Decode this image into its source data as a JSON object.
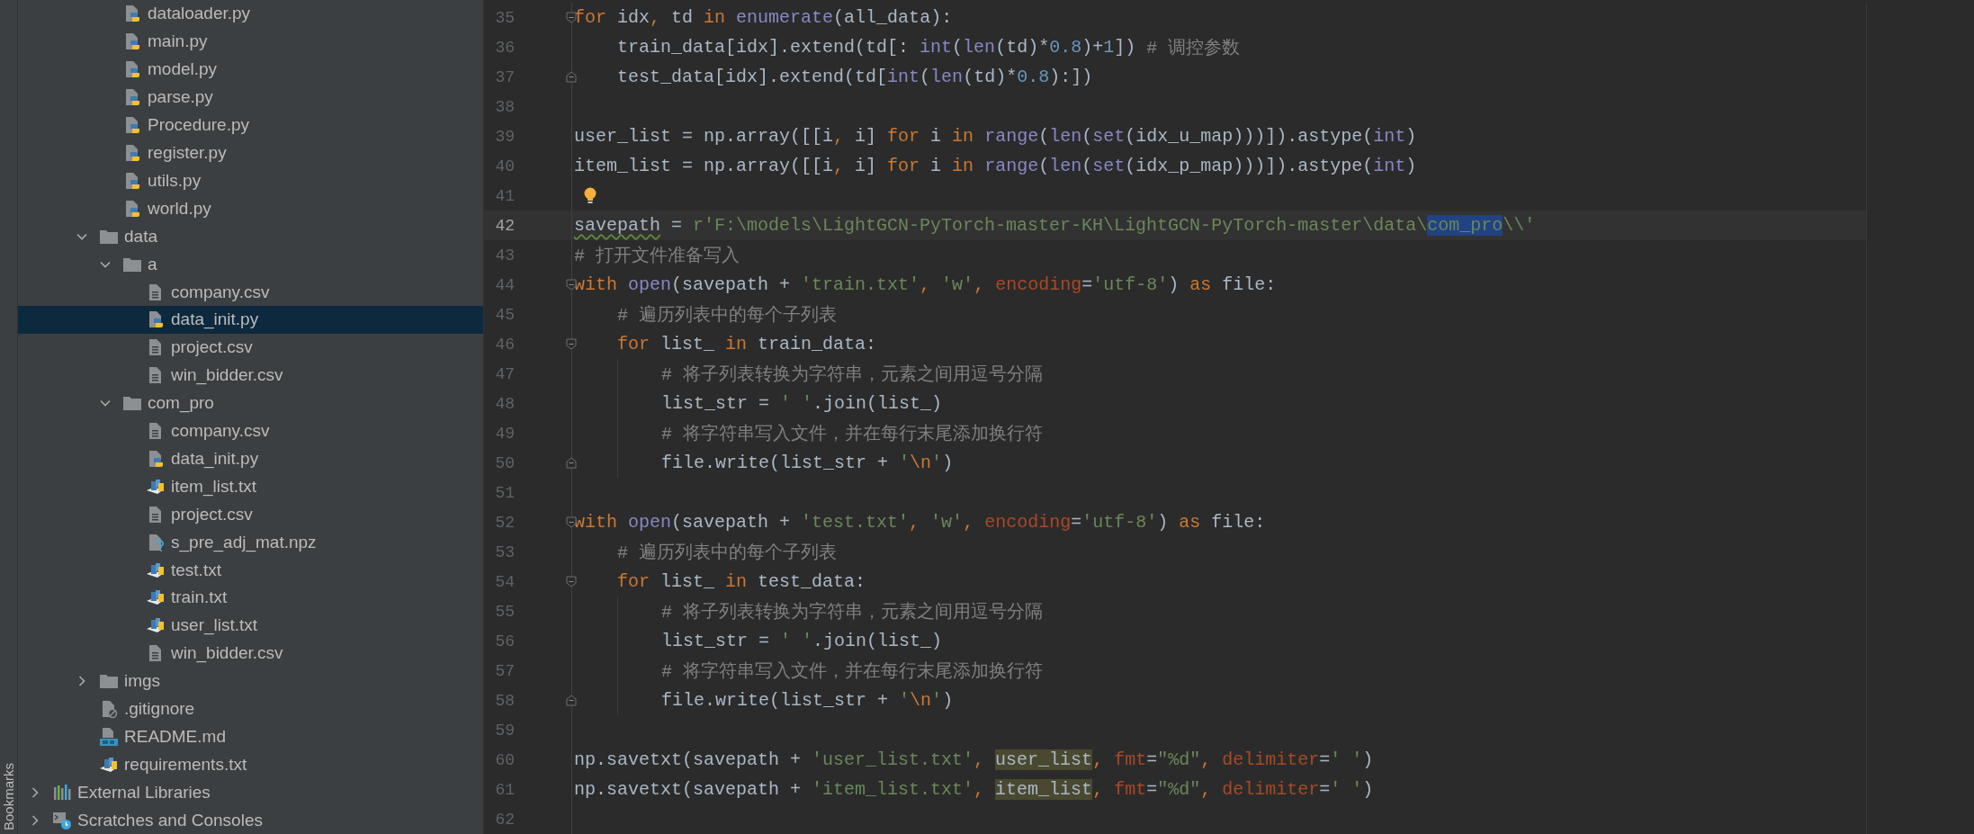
{
  "sidebar": {
    "label": "Bookmarks"
  },
  "tree": [
    {
      "children": [
        {
          "children": [
            {
              "children": [
                {
                  "label": "dataloader.py",
                  "kind": "python",
                  "selected": false
                },
                {
                  "label": "main.py",
                  "kind": "python",
                  "selected": false
                },
                {
                  "label": "model.py",
                  "kind": "python",
                  "selected": false
                },
                {
                  "label": "parse.py",
                  "kind": "python",
                  "selected": false
                },
                {
                  "label": "Procedure.py",
                  "kind": "python",
                  "selected": false
                },
                {
                  "label": "register.py",
                  "kind": "python",
                  "selected": false
                },
                {
                  "label": "utils.py",
                  "kind": "python",
                  "selected": false
                },
                {
                  "label": "world.py",
                  "kind": "python",
                  "selected": false
                }
              ]
            },
            {
              "label": "data",
              "kind": "folder",
              "expanded": true,
              "selected": false,
              "children": [
                {
                  "label": "a",
                  "kind": "folder",
                  "expanded": true,
                  "selected": false,
                  "children": [
                    {
                      "label": "company.csv",
                      "kind": "csv",
                      "selected": false
                    },
                    {
                      "label": "data_init.py",
                      "kind": "python",
                      "selected": true
                    },
                    {
                      "label": "project.csv",
                      "kind": "csv",
                      "selected": false
                    },
                    {
                      "label": "win_bidder.csv",
                      "kind": "csv",
                      "selected": false
                    }
                  ]
                },
                {
                  "label": "com_pro",
                  "kind": "folder",
                  "expanded": true,
                  "selected": false,
                  "children": [
                    {
                      "label": "company.csv",
                      "kind": "csv",
                      "selected": false
                    },
                    {
                      "label": "data_init.py",
                      "kind": "python",
                      "selected": false
                    },
                    {
                      "label": "item_list.txt",
                      "kind": "text",
                      "selected": false
                    },
                    {
                      "label": "project.csv",
                      "kind": "csv",
                      "selected": false
                    },
                    {
                      "label": "s_pre_adj_mat.npz",
                      "kind": "unknown",
                      "selected": false
                    },
                    {
                      "label": "test.txt",
                      "kind": "text",
                      "selected": false
                    },
                    {
                      "label": "train.txt",
                      "kind": "text",
                      "selected": false
                    },
                    {
                      "label": "user_list.txt",
                      "kind": "text",
                      "selected": false
                    },
                    {
                      "label": "win_bidder.csv",
                      "kind": "csv",
                      "selected": false
                    }
                  ]
                }
              ]
            },
            {
              "label": "imgs",
              "kind": "folder",
              "expanded": false,
              "selected": false
            },
            {
              "label": ".gitignore",
              "kind": "ignore",
              "selected": false
            },
            {
              "label": "README.md",
              "kind": "markdown",
              "selected": false
            },
            {
              "label": "requirements.txt",
              "kind": "text",
              "selected": false
            }
          ]
        }
      ]
    },
    {
      "label": "External Libraries",
      "kind": "libraries",
      "expanded": false,
      "selected": false
    },
    {
      "label": "Scratches and Consoles",
      "kind": "scratches",
      "expanded": false,
      "selected": false
    }
  ],
  "editor": {
    "lines": [
      {
        "number": "35",
        "current": false,
        "bulb": false,
        "fold_start": true,
        "fold_end": false,
        "tokens": [
          {
            "kind": "keyword",
            "text": "for"
          },
          {
            "kind": "plain",
            "text": " idx"
          },
          {
            "kind": "keyword",
            "text": ", "
          },
          {
            "kind": "plain",
            "text": "td "
          },
          {
            "kind": "keyword",
            "text": "in "
          },
          {
            "kind": "builtin",
            "text": "enumerate"
          },
          {
            "kind": "plain",
            "text": "(all_data):"
          }
        ],
        "children": [
          {
            "number": "36",
            "current": false,
            "bulb": false,
            "fold_start": false,
            "fold_end": false,
            "tokens": [
              {
                "kind": "plain",
                "text": "train_data[idx].extend(td[: "
              },
              {
                "kind": "builtin",
                "text": "int"
              },
              {
                "kind": "plain",
                "text": "("
              },
              {
                "kind": "builtin",
                "text": "len"
              },
              {
                "kind": "plain",
                "text": "(td)*"
              },
              {
                "kind": "number",
                "text": "0.8"
              },
              {
                "kind": "plain",
                "text": ")+"
              },
              {
                "kind": "number",
                "text": "1"
              },
              {
                "kind": "plain",
                "text": "]) "
              },
              {
                "kind": "comment",
                "text": "# 调控参数"
              }
            ]
          },
          {
            "number": "37",
            "current": false,
            "bulb": false,
            "fold_start": false,
            "fold_end": true,
            "tokens": [
              {
                "kind": "plain",
                "text": "test_data[idx].extend(td["
              },
              {
                "kind": "builtin",
                "text": "int"
              },
              {
                "kind": "plain",
                "text": "("
              },
              {
                "kind": "builtin",
                "text": "len"
              },
              {
                "kind": "plain",
                "text": "(td)*"
              },
              {
                "kind": "number",
                "text": "0.8"
              },
              {
                "kind": "plain",
                "text": "):])"
              }
            ]
          }
        ]
      },
      {
        "number": "38",
        "current": false,
        "bulb": false,
        "fold_start": false,
        "fold_end": false
      },
      {
        "number": "39",
        "current": false,
        "bulb": false,
        "fold_start": false,
        "fold_end": false,
        "tokens": [
          {
            "kind": "plain",
            "text": "user_list = np.array([[i"
          },
          {
            "kind": "keyword",
            "text": ", "
          },
          {
            "kind": "plain",
            "text": "i] "
          },
          {
            "kind": "keyword",
            "text": "for"
          },
          {
            "kind": "plain",
            "text": " i "
          },
          {
            "kind": "keyword",
            "text": "in "
          },
          {
            "kind": "builtin",
            "text": "range"
          },
          {
            "kind": "plain",
            "text": "("
          },
          {
            "kind": "builtin",
            "text": "len"
          },
          {
            "kind": "plain",
            "text": "("
          },
          {
            "kind": "builtin",
            "text": "set"
          },
          {
            "kind": "plain",
            "text": "(idx_u_map)))]).astype("
          },
          {
            "kind": "builtin",
            "text": "int"
          },
          {
            "kind": "plain",
            "text": ")"
          }
        ]
      },
      {
        "number": "40",
        "current": false,
        "bulb": false,
        "fold_start": false,
        "fold_end": false,
        "tokens": [
          {
            "kind": "plain",
            "text": "item_list = np.array([[i"
          },
          {
            "kind": "keyword",
            "text": ", "
          },
          {
            "kind": "plain",
            "text": "i] "
          },
          {
            "kind": "keyword",
            "text": "for"
          },
          {
            "kind": "plain",
            "text": " i "
          },
          {
            "kind": "keyword",
            "text": "in "
          },
          {
            "kind": "builtin",
            "text": "range"
          },
          {
            "kind": "plain",
            "text": "("
          },
          {
            "kind": "builtin",
            "text": "len"
          },
          {
            "kind": "plain",
            "text": "("
          },
          {
            "kind": "builtin",
            "text": "set"
          },
          {
            "kind": "plain",
            "text": "(idx_p_map)))]).astype("
          },
          {
            "kind": "builtin",
            "text": "int"
          },
          {
            "kind": "plain",
            "text": ")"
          }
        ]
      },
      {
        "number": "41",
        "current": false,
        "bulb": true,
        "fold_start": false,
        "fold_end": false
      },
      {
        "number": "42",
        "current": true,
        "bulb": false,
        "fold_start": false,
        "fold_end": false,
        "tokens": [
          {
            "kind": "warn",
            "text": "savepath"
          },
          {
            "kind": "plain",
            "text": " = "
          },
          {
            "kind": "string",
            "text": "r'F:\\models\\LightGCN-PyTorch-master-KH\\LightGCN-PyTorch-master\\data\\"
          },
          {
            "kind": "string",
            "text": "com_pro",
            "selected": true
          },
          {
            "kind": "string",
            "text": "\\\\'"
          }
        ]
      },
      {
        "number": "43",
        "current": false,
        "bulb": false,
        "fold_start": false,
        "fold_end": false,
        "tokens": [
          {
            "kind": "comment",
            "text": "# 打开文件准备写入"
          }
        ]
      },
      {
        "number": "44",
        "current": false,
        "bulb": false,
        "fold_start": true,
        "fold_end": false,
        "tokens": [
          {
            "kind": "keyword",
            "text": "with "
          },
          {
            "kind": "builtin",
            "text": "open"
          },
          {
            "kind": "plain",
            "text": "(savepath + "
          },
          {
            "kind": "string",
            "text": "'train.txt'"
          },
          {
            "kind": "keyword",
            "text": ", "
          },
          {
            "kind": "string",
            "text": "'w'"
          },
          {
            "kind": "keyword",
            "text": ", "
          },
          {
            "kind": "param",
            "text": "encoding"
          },
          {
            "kind": "plain",
            "text": "="
          },
          {
            "kind": "string",
            "text": "'utf-8'"
          },
          {
            "kind": "plain",
            "text": ") "
          },
          {
            "kind": "keyword",
            "text": "as"
          },
          {
            "kind": "plain",
            "text": " file:"
          }
        ],
        "children": [
          {
            "number": "45",
            "current": false,
            "bulb": false,
            "fold_start": false,
            "fold_end": false,
            "tokens": [
              {
                "kind": "comment",
                "text": "# 遍历列表中的每个子列表"
              }
            ]
          },
          {
            "number": "46",
            "current": false,
            "bulb": false,
            "fold_start": true,
            "fold_end": false,
            "tokens": [
              {
                "kind": "keyword",
                "text": "for"
              },
              {
                "kind": "plain",
                "text": " list_ "
              },
              {
                "kind": "keyword",
                "text": "in"
              },
              {
                "kind": "plain",
                "text": " train_data:"
              }
            ],
            "children": [
              {
                "number": "47",
                "current": false,
                "bulb": false,
                "fold_start": false,
                "fold_end": false,
                "tokens": [
                  {
                    "kind": "comment",
                    "text": "# 将子列表转换为字符串，元素之间用逗号分隔"
                  }
                ]
              },
              {
                "number": "48",
                "current": false,
                "bulb": false,
                "fold_start": false,
                "fold_end": false,
                "tokens": [
                  {
                    "kind": "plain",
                    "text": "list_str = "
                  },
                  {
                    "kind": "string",
                    "text": "' '"
                  },
                  {
                    "kind": "plain",
                    "text": ".join(list_)"
                  }
                ]
              },
              {
                "number": "49",
                "current": false,
                "bulb": false,
                "fold_start": false,
                "fold_end": false,
                "tokens": [
                  {
                    "kind": "comment",
                    "text": "# 将字符串写入文件，并在每行末尾添加换行符"
                  }
                ]
              },
              {
                "number": "50",
                "current": false,
                "bulb": false,
                "fold_start": false,
                "fold_end": true,
                "tokens": [
                  {
                    "kind": "plain",
                    "text": "file.write(list_str + "
                  },
                  {
                    "kind": "string",
                    "text": "'"
                  },
                  {
                    "kind": "escape",
                    "text": "\\n"
                  },
                  {
                    "kind": "string",
                    "text": "'"
                  },
                  {
                    "kind": "plain",
                    "text": ")"
                  }
                ]
              }
            ]
          }
        ]
      },
      {
        "number": "51",
        "current": false,
        "bulb": false,
        "fold_start": false,
        "fold_end": false
      },
      {
        "number": "52",
        "current": false,
        "bulb": false,
        "fold_start": true,
        "fold_end": false,
        "tokens": [
          {
            "kind": "keyword",
            "text": "with "
          },
          {
            "kind": "builtin",
            "text": "open"
          },
          {
            "kind": "plain",
            "text": "(savepath + "
          },
          {
            "kind": "string",
            "text": "'test.txt'"
          },
          {
            "kind": "keyword",
            "text": ", "
          },
          {
            "kind": "string",
            "text": "'w'"
          },
          {
            "kind": "keyword",
            "text": ", "
          },
          {
            "kind": "param",
            "text": "encoding"
          },
          {
            "kind": "plain",
            "text": "="
          },
          {
            "kind": "string",
            "text": "'utf-8'"
          },
          {
            "kind": "plain",
            "text": ") "
          },
          {
            "kind": "keyword",
            "text": "as"
          },
          {
            "kind": "plain",
            "text": " file:"
          }
        ],
        "children": [
          {
            "number": "53",
            "current": false,
            "bulb": false,
            "fold_start": false,
            "fold_end": false,
            "tokens": [
              {
                "kind": "comment",
                "text": "# 遍历列表中的每个子列表"
              }
            ]
          },
          {
            "number": "54",
            "current": false,
            "bulb": false,
            "fold_start": true,
            "fold_end": false,
            "tokens": [
              {
                "kind": "keyword",
                "text": "for"
              },
              {
                "kind": "plain",
                "text": " list_ "
              },
              {
                "kind": "keyword",
                "text": "in"
              },
              {
                "kind": "plain",
                "text": " test_data:"
              }
            ],
            "children": [
              {
                "number": "55",
                "current": false,
                "bulb": false,
                "fold_start": false,
                "fold_end": false,
                "tokens": [
                  {
                    "kind": "comment",
                    "text": "# 将子列表转换为字符串，元素之间用逗号分隔"
                  }
                ]
              },
              {
                "number": "56",
                "current": false,
                "bulb": false,
                "fold_start": false,
                "fold_end": false,
                "tokens": [
                  {
                    "kind": "plain",
                    "text": "list_str = "
                  },
                  {
                    "kind": "string",
                    "text": "' '"
                  },
                  {
                    "kind": "plain",
                    "text": ".join(list_)"
                  }
                ]
              },
              {
                "number": "57",
                "current": false,
                "bulb": false,
                "fold_start": false,
                "fold_end": false,
                "tokens": [
                  {
                    "kind": "comment",
                    "text": "# 将字符串写入文件，并在每行末尾添加换行符"
                  }
                ]
              },
              {
                "number": "58",
                "current": false,
                "bulb": false,
                "fold_start": false,
                "fold_end": true,
                "tokens": [
                  {
                    "kind": "plain",
                    "text": "file.write(list_str + "
                  },
                  {
                    "kind": "string",
                    "text": "'"
                  },
                  {
                    "kind": "escape",
                    "text": "\\n"
                  },
                  {
                    "kind": "string",
                    "text": "'"
                  },
                  {
                    "kind": "plain",
                    "text": ")"
                  }
                ]
              }
            ]
          }
        ]
      },
      {
        "number": "59",
        "current": false,
        "bulb": false,
        "fold_start": false,
        "fold_end": false
      },
      {
        "number": "60",
        "current": false,
        "bulb": false,
        "fold_start": false,
        "fold_end": false,
        "tokens": [
          {
            "kind": "plain",
            "text": "np.savetxt(savepath + "
          },
          {
            "kind": "string",
            "text": "'user_list.txt'"
          },
          {
            "kind": "keyword",
            "text": ", "
          },
          {
            "kind": "plain",
            "text": "user_list",
            "highlighted": true
          },
          {
            "kind": "keyword",
            "text": ", "
          },
          {
            "kind": "param",
            "text": "fmt"
          },
          {
            "kind": "plain",
            "text": "="
          },
          {
            "kind": "string",
            "text": "\"%d\""
          },
          {
            "kind": "keyword",
            "text": ", "
          },
          {
            "kind": "param",
            "text": "delimiter"
          },
          {
            "kind": "plain",
            "text": "="
          },
          {
            "kind": "string",
            "text": "' '"
          },
          {
            "kind": "plain",
            "text": ")"
          }
        ]
      },
      {
        "number": "61",
        "current": false,
        "bulb": false,
        "fold_start": false,
        "fold_end": false,
        "tokens": [
          {
            "kind": "plain",
            "text": "np.savetxt(savepath + "
          },
          {
            "kind": "string",
            "text": "'item_list.txt'"
          },
          {
            "kind": "keyword",
            "text": ", "
          },
          {
            "kind": "plain",
            "text": "item_list",
            "highlighted": true
          },
          {
            "kind": "keyword",
            "text": ", "
          },
          {
            "kind": "param",
            "text": "fmt"
          },
          {
            "kind": "plain",
            "text": "="
          },
          {
            "kind": "string",
            "text": "\"%d\""
          },
          {
            "kind": "keyword",
            "text": ", "
          },
          {
            "kind": "param",
            "text": "delimiter"
          },
          {
            "kind": "plain",
            "text": "="
          },
          {
            "kind": "string",
            "text": "' '"
          },
          {
            "kind": "plain",
            "text": ")"
          }
        ]
      },
      {
        "number": "62",
        "current": false,
        "bulb": false,
        "fold_start": false,
        "fold_end": false
      }
    ]
  }
}
